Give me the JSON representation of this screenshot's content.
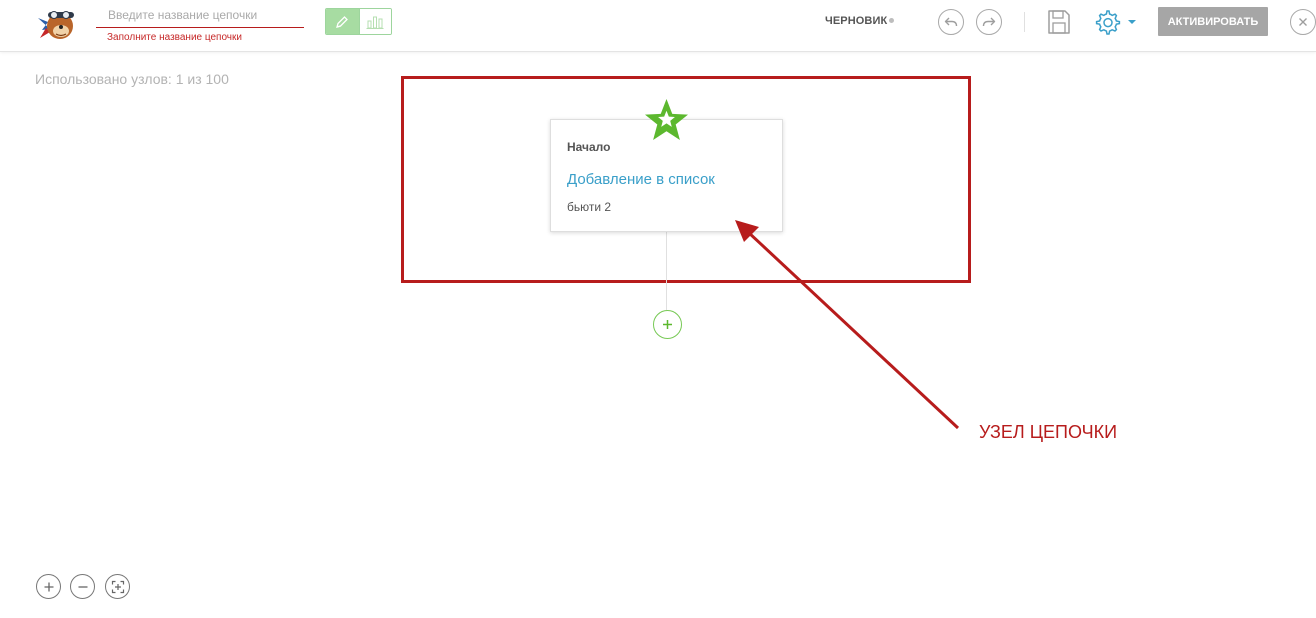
{
  "header": {
    "chain_name": {
      "value": "",
      "placeholder": "Введите название цепочки",
      "error": "Заполните название цепочки"
    },
    "mode_toggle": {
      "active": "edit-pencil-icon",
      "inactive": "stats-bars-icon"
    },
    "status": "ЧЕРНОВИК",
    "undo_icon": "undo-icon",
    "redo_icon": "redo-icon",
    "save_icon": "floppy-disk-icon",
    "settings_icon": "gear-icon",
    "activate_label": "АКТИВИРОВАТЬ",
    "close_icon": "close-icon"
  },
  "canvas": {
    "nodes_used": "Использовано узлов: 1 из 100",
    "start_node": {
      "title": "Начало",
      "action": "Добавление в список",
      "list_name": "бьюти 2"
    },
    "add_node_icon": "plus-icon"
  },
  "annotation": {
    "label": "УЗЕЛ ЦЕПОЧКИ",
    "color": "#b71c1c"
  },
  "zoom_controls": [
    "zoom-in-icon",
    "zoom-out-icon",
    "fit-screen-icon"
  ],
  "colors": {
    "accent_green": "#5cb82e",
    "link_blue": "#3a9fc9",
    "error_red": "#c62828",
    "activate_gray": "#a6a6a6"
  }
}
